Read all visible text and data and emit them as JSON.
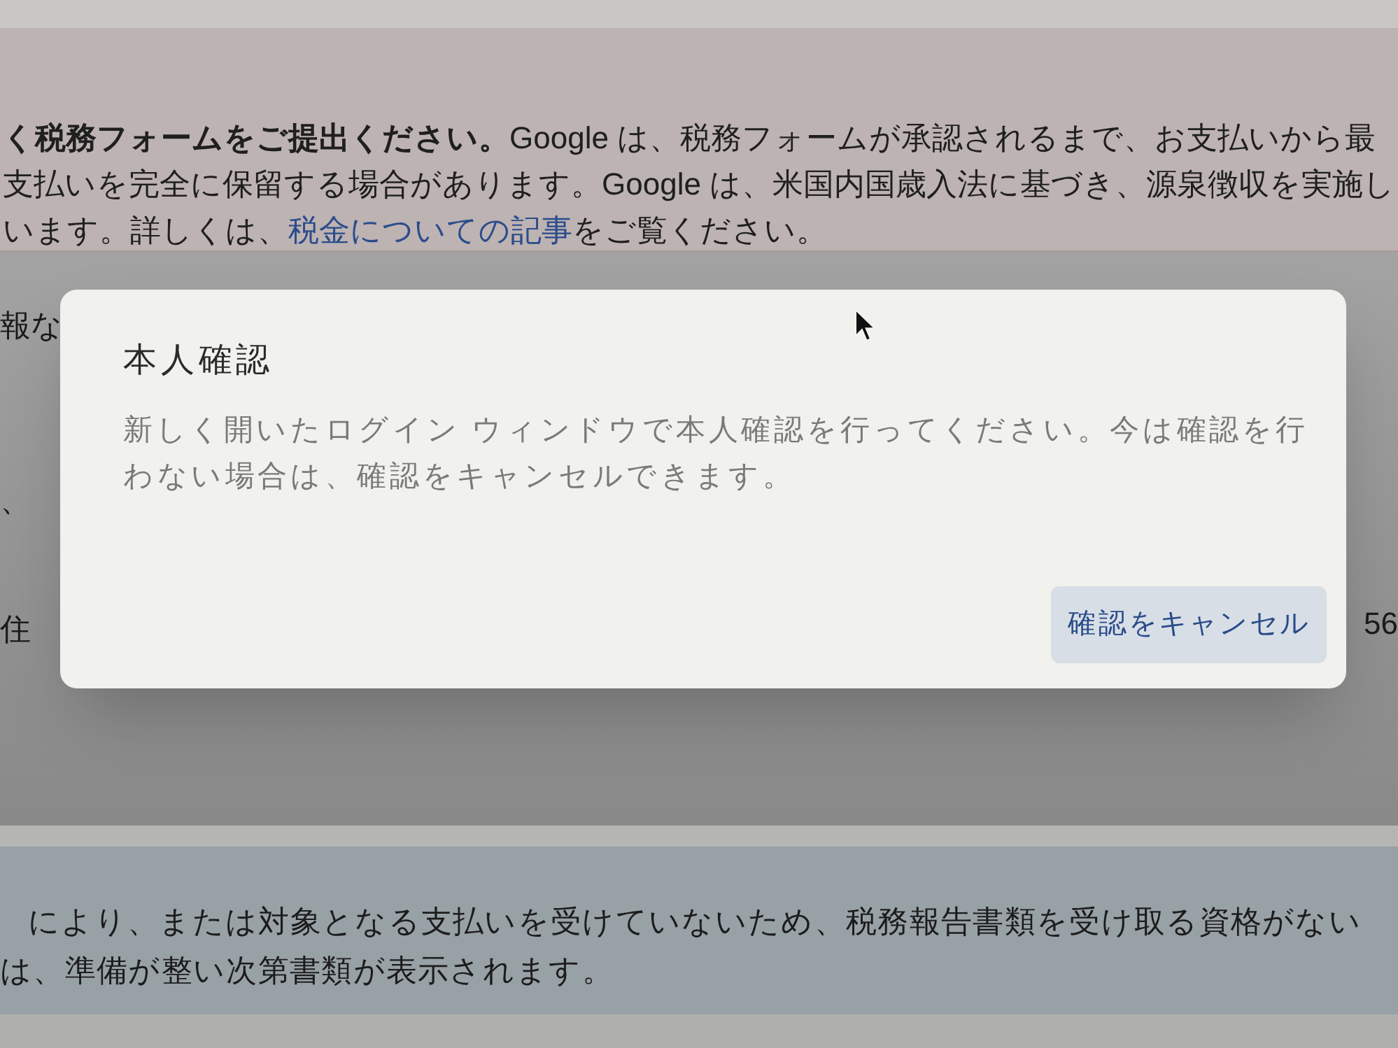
{
  "tax_notice": {
    "lines": [
      "**く税務フォームをご提出ください。**Google は、税務フォームが承認されるまで、お支払いから最",
      "支払いを完全に保留する場合があります。Google は、米国内国歳入法に基づき、源泉徴収を実施し"
    ],
    "last_line": {
      "before": "います。詳しくは、",
      "link": "税金についての記事",
      "after": "をご覧ください。"
    }
  },
  "left_edge_texts": [
    "報な",
    "、",
    "住"
  ],
  "right_edge_text": "56",
  "bottom_notice": {
    "lines": [
      "により、または対象となる支払いを受けていないため、税務報告書類を受け取る資格がない",
      "は、準備が整い次第書類が表示されます。"
    ]
  },
  "dialog": {
    "title": "本人確認",
    "message": "新しく開いたログイン ウィンドウで本人確認を行ってください。今は確認を行わない場合は、確認をキャンセルできます。",
    "buttons": [
      {
        "label": "確認をキャンセル",
        "kind": "tonal"
      }
    ]
  }
}
